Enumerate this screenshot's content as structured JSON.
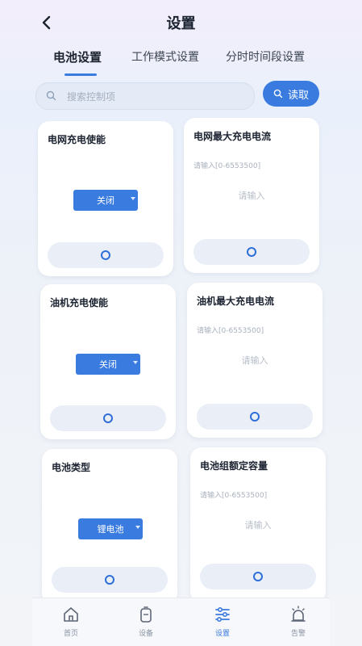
{
  "header": {
    "title": "设置"
  },
  "tabs": [
    {
      "label": "电池设置",
      "active": true
    },
    {
      "label": "工作模式设置",
      "active": false
    },
    {
      "label": "分时时间段设置",
      "active": false
    }
  ],
  "search": {
    "placeholder": "搜索控制项",
    "button_label": "读取"
  },
  "cards": [
    {
      "title": "电网充电使能",
      "type": "select",
      "value": "关闭"
    },
    {
      "title": "电网最大充电电流",
      "type": "input",
      "hint": "请输入[0-6553500]",
      "placeholder": "请输入"
    },
    {
      "title": "油机充电使能",
      "type": "select",
      "value": "关闭"
    },
    {
      "title": "油机最大充电电流",
      "type": "input",
      "hint": "请输入[0-6553500]",
      "placeholder": "请输入"
    },
    {
      "title": "电池类型",
      "type": "select",
      "value": "锂电池"
    },
    {
      "title": "电池组额定容量",
      "type": "input",
      "hint": "请输入[0-6553500]",
      "placeholder": "请输入"
    }
  ],
  "tabbar": [
    {
      "label": "首页",
      "icon": "home-icon",
      "active": false
    },
    {
      "label": "设备",
      "icon": "battery-icon",
      "active": false
    },
    {
      "label": "设置",
      "icon": "sliders-icon",
      "active": true
    },
    {
      "label": "告警",
      "icon": "alarm-icon",
      "active": false
    }
  ],
  "colors": {
    "accent": "#3a7be0",
    "background": "#eef2f8",
    "card": "#ffffff"
  }
}
